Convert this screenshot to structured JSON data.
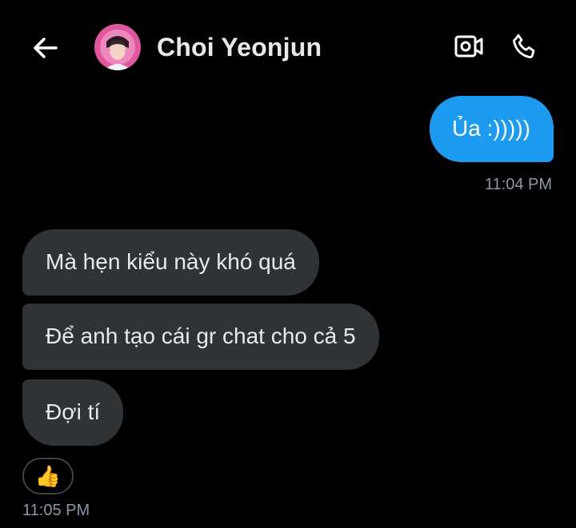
{
  "header": {
    "back_icon": "arrow-left-icon",
    "contact_name": "Choi Yeonjun",
    "video_icon": "video-camera-icon",
    "call_icon": "phone-icon"
  },
  "messages": [
    {
      "direction": "sent",
      "text": "Ủa :)))))"
    },
    {
      "direction": "received",
      "text": "Mà hẹn kiểu này khó quá"
    },
    {
      "direction": "received",
      "text": "Để anh tạo cái gr chat cho cả 5"
    },
    {
      "direction": "received",
      "text": "Đợi tí"
    }
  ],
  "timestamps": {
    "sent": "11:04 PM",
    "received": "11:05 PM"
  },
  "reaction": {
    "emoji": "👍",
    "icon": "thumbs-up-icon"
  },
  "colors": {
    "background": "#000000",
    "sent_bubble": "#1d9bf0",
    "received_bubble": "#2f3336",
    "timestamp": "#8b98a5",
    "text": "#e7e9ea"
  }
}
